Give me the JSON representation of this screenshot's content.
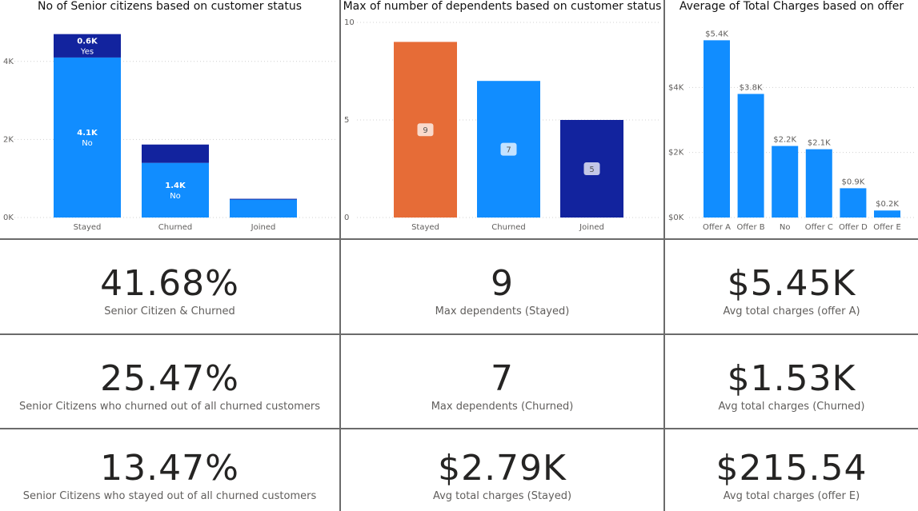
{
  "colors": {
    "light_blue": "#118DFF",
    "dark_blue": "#12239E",
    "orange": "#E66C37",
    "grid": "#d0d0d0"
  },
  "charts": {
    "senior": {
      "title": "No of Senior citizens based on customer status"
    },
    "dependents": {
      "title": "Max of number of dependents based on customer status"
    },
    "charges": {
      "title": "Average of Total Charges based on offer"
    }
  },
  "chart_data": [
    {
      "type": "bar",
      "stacked": true,
      "title": "No of Senior citizens based on customer status",
      "categories": [
        "Stayed",
        "Churned",
        "Joined"
      ],
      "series": [
        {
          "name": "No",
          "values": [
            4100,
            1400,
            460
          ]
        },
        {
          "name": "Yes",
          "values": [
            600,
            470,
            20
          ]
        }
      ],
      "data_labels": [
        {
          "category": "Stayed",
          "series": "No",
          "text": "4.1K"
        },
        {
          "category": "Stayed",
          "series": "Yes",
          "text": "0.6K"
        },
        {
          "category": "Churned",
          "series": "No",
          "text": "1.4K"
        }
      ],
      "yticks": [
        "0K",
        "2K",
        "4K"
      ],
      "ylim": [
        0,
        5000
      ],
      "grid": true
    },
    {
      "type": "bar",
      "title": "Max of number of dependents based on customer status",
      "categories": [
        "Stayed",
        "Churned",
        "Joined"
      ],
      "values": [
        9,
        7,
        5
      ],
      "data_labels": [
        "9",
        "7",
        "5"
      ],
      "yticks": [
        "0",
        "5",
        "10"
      ],
      "ylim": [
        0,
        10
      ],
      "grid": true
    },
    {
      "type": "bar",
      "title": "Average of Total Charges based on offer",
      "categories": [
        "Offer A",
        "Offer B",
        "No",
        "Offer C",
        "Offer D",
        "Offer E"
      ],
      "values": [
        5450,
        3800,
        2200,
        2100,
        900,
        215.54
      ],
      "data_labels": [
        "$5.4K",
        "$3.8K",
        "$2.2K",
        "$2.1K",
        "$0.9K",
        "$0.2K"
      ],
      "yticks": [
        "$0K",
        "$2K",
        "$4K"
      ],
      "ylim": [
        0,
        6000
      ],
      "grid": true
    }
  ],
  "kpis": [
    {
      "value": "41.68%",
      "label": "Senior Citizen & Churned"
    },
    {
      "value": "9",
      "label": "Max dependents (Stayed)"
    },
    {
      "value": "$5.45K",
      "label": "Avg total charges (offer A)"
    },
    {
      "value": "25.47%",
      "label": "Senior Citizens who churned out of all churned customers"
    },
    {
      "value": "7",
      "label": "Max dependents (Churned)"
    },
    {
      "value": "$1.53K",
      "label": "Avg total charges (Churned)"
    },
    {
      "value": "13.47%",
      "label": "Senior Citizens who stayed out of all churned customers"
    },
    {
      "value": "$2.79K",
      "label": "Avg total charges (Stayed)"
    },
    {
      "value": "$215.54",
      "label": "Avg total charges (offer E)"
    }
  ]
}
